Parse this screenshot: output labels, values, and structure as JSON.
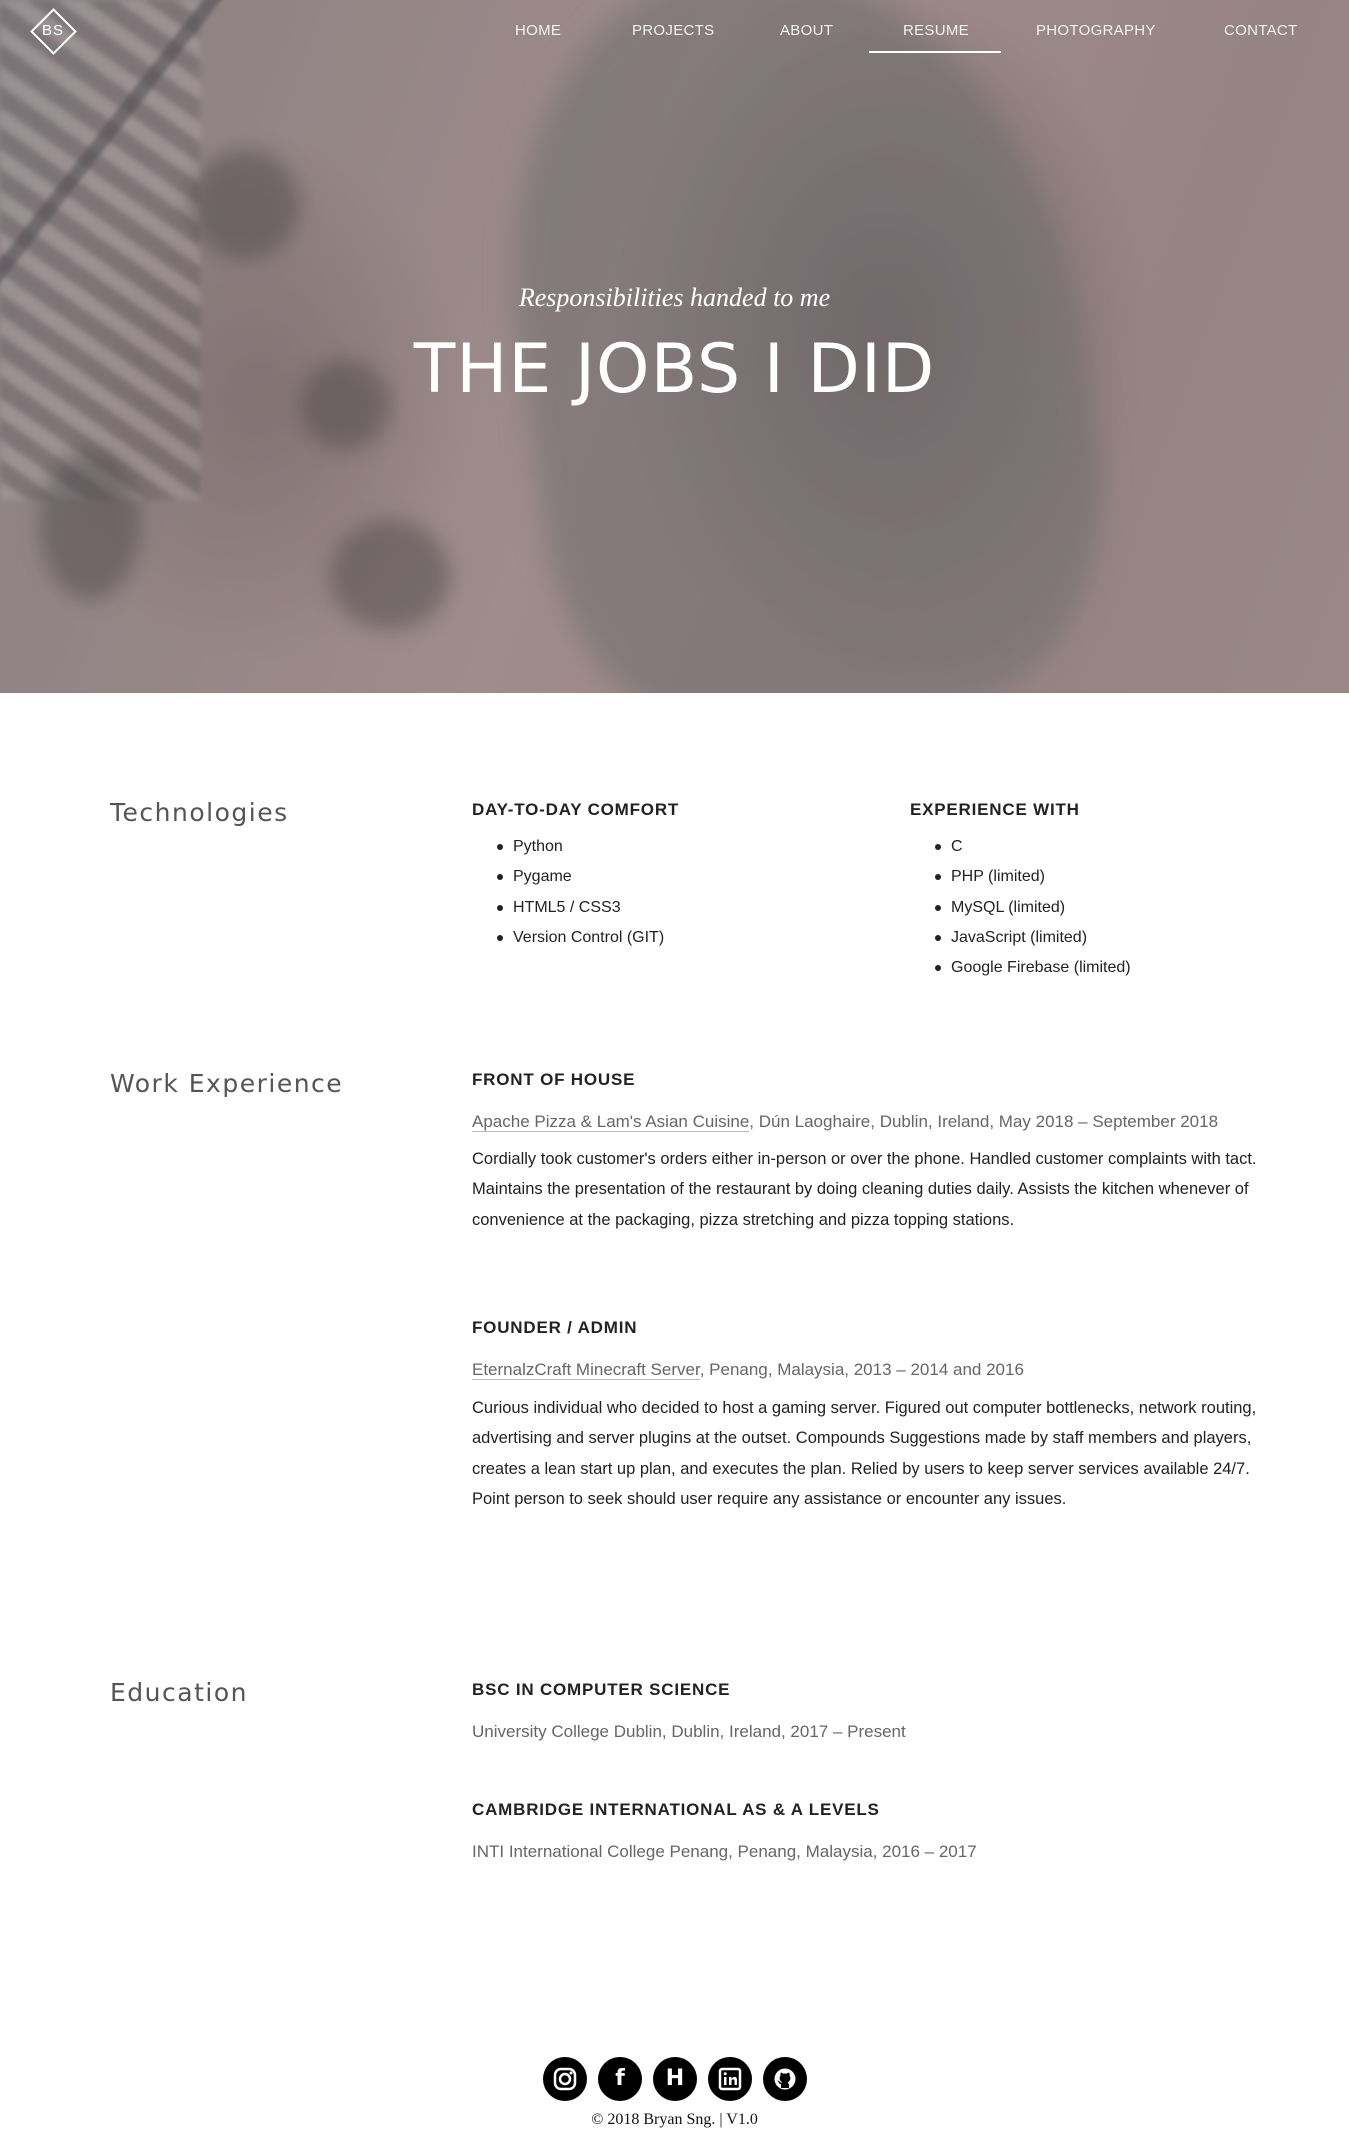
{
  "logo": {
    "text": "BS"
  },
  "nav": {
    "items": [
      "HOME",
      "PROJECTS",
      "ABOUT",
      "RESUME",
      "PHOTOGRAPHY",
      "CONTACT"
    ],
    "active": "RESUME"
  },
  "hero": {
    "subtitle": "Responsibilities handed to me",
    "title": "THE JOBS I DID"
  },
  "technologies": {
    "title": "Technologies",
    "comfort": {
      "heading": "DAY-TO-DAY COMFORT",
      "items": [
        "Python",
        "Pygame",
        "HTML5 / CSS3",
        "Version Control (GIT)"
      ]
    },
    "experience": {
      "heading": "EXPERIENCE WITH",
      "items": [
        "C",
        "PHP (limited)",
        "MySQL (limited)",
        "JavaScript (limited)",
        "Google Firebase (limited)"
      ]
    }
  },
  "work": {
    "title": "Work Experience",
    "jobs": [
      {
        "role": "FRONT OF HOUSE",
        "org": "Apache Pizza & Lam's Asian Cuisine",
        "details": ", Dún Laoghaire, Dublin, Ireland, May 2018 – September 2018",
        "description": "Cordially took customer's orders either in-person or over the phone. Handled customer complaints with tact. Maintains the presentation of the restaurant by doing cleaning duties daily. Assists the kitchen whenever of convenience at the packaging, pizza stretching and pizza topping stations."
      },
      {
        "role": "FOUNDER / ADMIN",
        "org": "EternalzCraft Minecraft Server",
        "details": ", Penang, Malaysia, 2013 – 2014 and 2016",
        "description": "Curious individual who decided to host a gaming server. Figured out computer bottlenecks, network routing, advertising and server plugins at the outset. Compounds Suggestions made by staff members and players, creates a lean start up plan, and executes the plan. Relied by users to keep server services available 24/7. Point person to seek should user require any assistance or encounter any issues."
      }
    ]
  },
  "education": {
    "title": "Education",
    "items": [
      {
        "degree": "BSC IN COMPUTER SCIENCE",
        "details": "University College Dublin, Dublin, Ireland, 2017 – Present"
      },
      {
        "degree": "CAMBRIDGE INTERNATIONAL AS & A LEVELS",
        "details": "INTI International College Penang, Penang, Malaysia, 2016 – 2017"
      }
    ]
  },
  "footer": {
    "socials": [
      "instagram-icon",
      "facebook-icon",
      "hackerrank-icon",
      "linkedin-icon",
      "github-icon"
    ],
    "copyright": "© 2018 Bryan Sng.  |  V1.0"
  }
}
